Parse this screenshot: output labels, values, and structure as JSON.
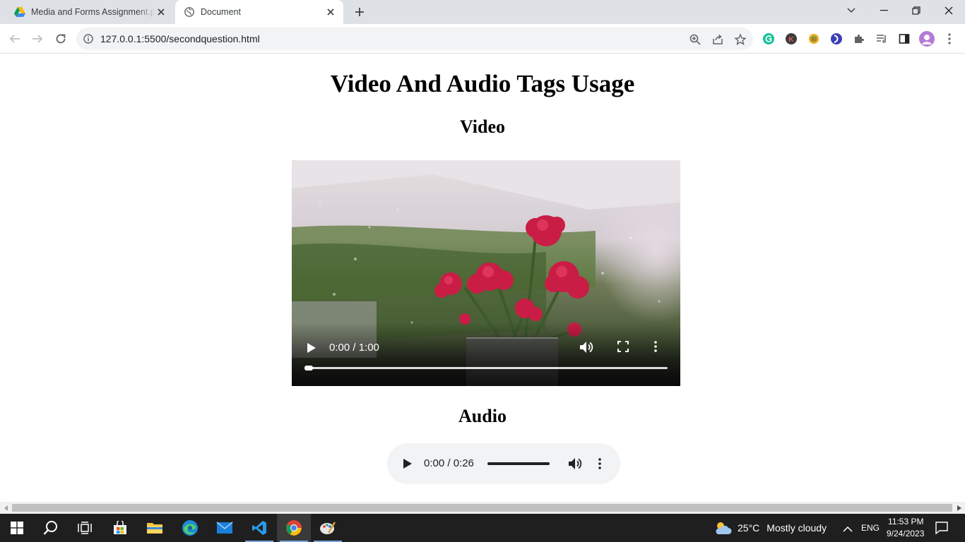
{
  "browser": {
    "tabs": [
      {
        "title": "Media and Forms Assignment.pdf",
        "icon": "google-drive-icon",
        "active": false
      },
      {
        "title": "Document",
        "icon": "globe-icon",
        "active": true
      }
    ],
    "url": "127.0.0.1:5500/secondquestion.html"
  },
  "page": {
    "title": "Video And Audio Tags Usage",
    "video_heading": "Video",
    "audio_heading": "Audio",
    "video_player": {
      "time": "0:00 / 1:00",
      "progress": 0
    },
    "audio_player": {
      "time": "0:00 / 0:26",
      "progress": 0
    }
  },
  "taskbar": {
    "weather": {
      "temp": "25°C",
      "condition": "Mostly cloudy"
    },
    "language": "ENG",
    "time": "11:53 PM",
    "date": "9/24/2023"
  },
  "colors": {
    "tabstrip": "#dee1e6",
    "omnibox": "#f1f3f4",
    "taskbar": "#1f1f1f"
  }
}
